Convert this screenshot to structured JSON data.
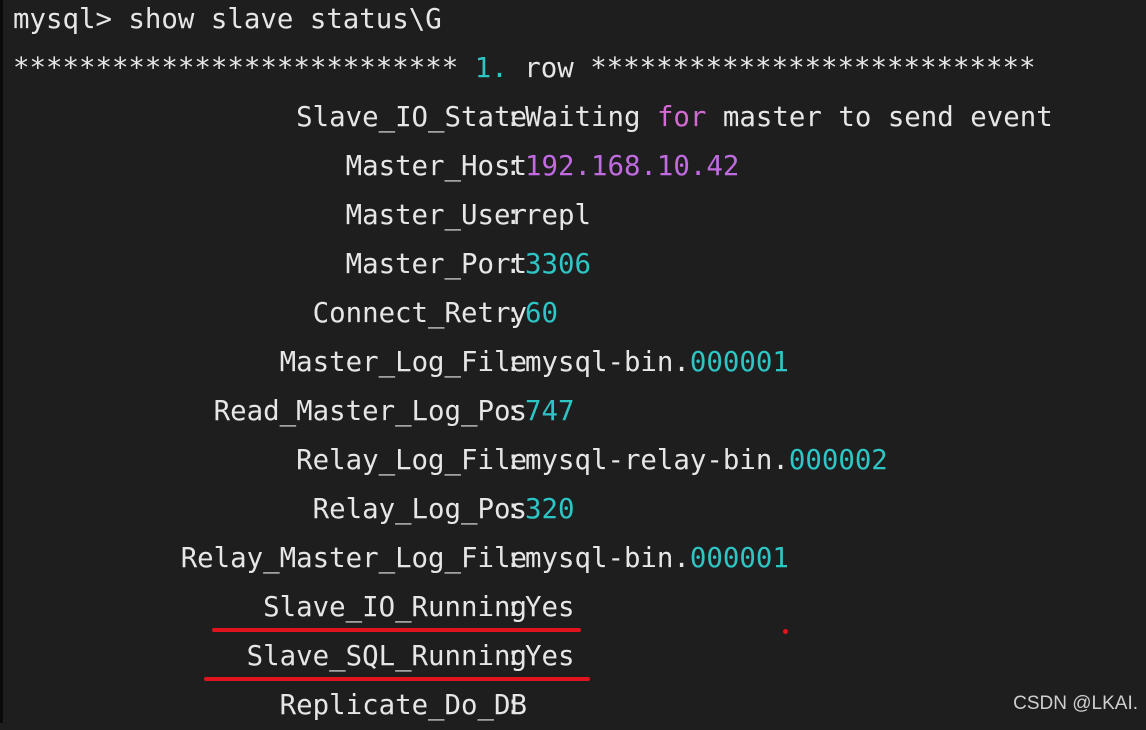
{
  "terminal": {
    "prompt_line": "mysql> show slave status\\G",
    "row_header": {
      "stars_left": "*************************** ",
      "row_num": "1.",
      "row_word": " row ",
      "stars_right": "***************************"
    },
    "fields": [
      {
        "key": "Slave_IO_State",
        "value_parts": [
          {
            "text": "Waiting ",
            "style": "plain"
          },
          {
            "text": "for",
            "style": "kw"
          },
          {
            "text": " master to send event",
            "style": "plain"
          }
        ]
      },
      {
        "key": "Master_Host",
        "value_parts": [
          {
            "text": "192.168.10.42",
            "style": "ip"
          }
        ]
      },
      {
        "key": "Master_User",
        "value_parts": [
          {
            "text": "repl",
            "style": "plain"
          }
        ]
      },
      {
        "key": "Master_Port",
        "value_parts": [
          {
            "text": "3306",
            "style": "num"
          }
        ]
      },
      {
        "key": "Connect_Retry",
        "value_parts": [
          {
            "text": "60",
            "style": "num"
          }
        ]
      },
      {
        "key": "Master_Log_File",
        "value_parts": [
          {
            "text": "mysql-bin.",
            "style": "plain"
          },
          {
            "text": "000001",
            "style": "num"
          }
        ]
      },
      {
        "key": "Read_Master_Log_Pos",
        "value_parts": [
          {
            "text": "747",
            "style": "num"
          }
        ]
      },
      {
        "key": "Relay_Log_File",
        "value_parts": [
          {
            "text": "mysql-relay-bin.",
            "style": "plain"
          },
          {
            "text": "000002",
            "style": "num"
          }
        ]
      },
      {
        "key": "Relay_Log_Pos",
        "value_parts": [
          {
            "text": "320",
            "style": "num"
          }
        ]
      },
      {
        "key": "Relay_Master_Log_File",
        "value_parts": [
          {
            "text": "mysql-bin.",
            "style": "plain"
          },
          {
            "text": "000001",
            "style": "num"
          }
        ]
      },
      {
        "key": "Slave_IO_Running",
        "value_parts": [
          {
            "text": "Yes",
            "style": "plain"
          }
        ]
      },
      {
        "key": "Slave_SQL_Running",
        "value_parts": [
          {
            "text": "Yes",
            "style": "plain"
          }
        ]
      },
      {
        "key": "Replicate_Do_DB",
        "value_parts": []
      }
    ]
  },
  "watermark": "CSDN @LKAI.",
  "colors": {
    "background": "#1e1e1e",
    "text": "#e6e6e6",
    "number": "#2ec5c5",
    "keyword": "#d36ad3",
    "annotation": "#e0141e"
  }
}
